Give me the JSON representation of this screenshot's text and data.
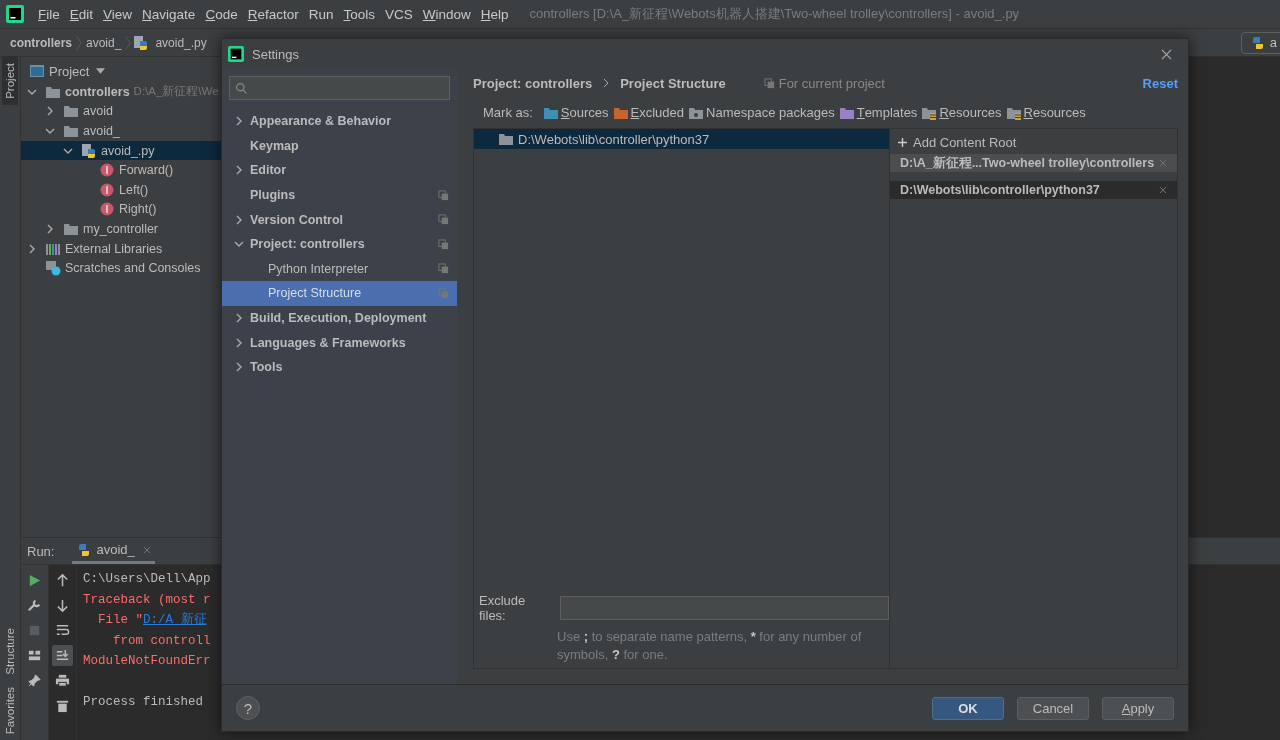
{
  "menu_bar": {
    "items": [
      {
        "label": "File",
        "mnemonic": true
      },
      {
        "label": "Edit",
        "mnemonic": true
      },
      {
        "label": "View",
        "mnemonic": true
      },
      {
        "label": "Navigate",
        "mnemonic": true
      },
      {
        "label": "Code",
        "mnemonic": true
      },
      {
        "label": "Refactor",
        "mnemonic": true
      },
      {
        "label": "Run",
        "mnemonic": false
      },
      {
        "label": "Tools",
        "mnemonic": true
      },
      {
        "label": "VCS",
        "mnemonic": false
      },
      {
        "label": "Window",
        "mnemonic": true
      },
      {
        "label": "Help",
        "mnemonic": true
      }
    ],
    "title": "controllers [D:\\A_新征程\\Webots机器人搭建\\Two-wheel trolley\\controllers] - avoid_.py"
  },
  "breadcrumb": [
    {
      "label": "controllers",
      "kind": "project"
    },
    {
      "label": "avoid_",
      "kind": "folder"
    },
    {
      "label": "avoid_.py",
      "kind": "python"
    }
  ],
  "editor_tab": {
    "label": "a"
  },
  "tool_stripe": {
    "top": [
      {
        "label": "Project",
        "selected": true
      }
    ],
    "bottom": [
      {
        "label": "Structure",
        "selected": false
      },
      {
        "label": "Favorites",
        "selected": false
      }
    ]
  },
  "project_panel": {
    "title": "Project",
    "tree": [
      {
        "label": "controllers",
        "hint": "D:\\A_新征程\\We",
        "kind": "folder",
        "bold": true,
        "expanded": true,
        "selected": false,
        "children": [
          {
            "label": "avoid",
            "kind": "folder",
            "expanded": false,
            "selected": false
          },
          {
            "label": "avoid_",
            "kind": "folder",
            "expanded": true,
            "selected": false,
            "children": [
              {
                "label": "avoid_.py",
                "kind": "python",
                "expanded": true,
                "selected": true,
                "children": [
                  {
                    "label": "Forward()",
                    "kind": "function",
                    "selected": false
                  },
                  {
                    "label": "Left()",
                    "kind": "function",
                    "selected": false
                  },
                  {
                    "label": "Right()",
                    "kind": "function",
                    "selected": false
                  }
                ]
              }
            ]
          },
          {
            "label": "my_controller",
            "kind": "folder",
            "expanded": false,
            "selected": false
          }
        ]
      },
      {
        "label": "External Libraries",
        "kind": "library",
        "expanded": false,
        "selected": false
      },
      {
        "label": "Scratches and Consoles",
        "kind": "scratches",
        "selected": false
      }
    ]
  },
  "run_panel": {
    "label": "Run:",
    "tab": {
      "label": "avoid_"
    },
    "lines": [
      {
        "kind": "output",
        "text": "C:\\Users\\Dell\\App"
      },
      {
        "kind": "error",
        "text": "Traceback (most r"
      },
      {
        "kind": "error",
        "text": "  File \"",
        "link": "D:/A_新征"
      },
      {
        "kind": "error",
        "text": "    from controll"
      },
      {
        "kind": "error",
        "text": "ModuleNotFoundErr"
      },
      {
        "kind": "status",
        "text": "Process finished"
      }
    ]
  },
  "settings": {
    "title": "Settings",
    "nav": [
      {
        "label": "Appearance & Behavior",
        "expanded": false,
        "shared": false,
        "selected": false
      },
      {
        "label": "Keymap",
        "shared": false,
        "selected": false
      },
      {
        "label": "Editor",
        "expanded": false,
        "shared": false,
        "selected": false
      },
      {
        "label": "Plugins",
        "shared": true,
        "selected": false
      },
      {
        "label": "Version Control",
        "expanded": false,
        "shared": true,
        "selected": false
      },
      {
        "label": "Project: controllers",
        "expanded": true,
        "shared": true,
        "selected": false,
        "children": [
          {
            "label": "Python Interpreter",
            "shared": true,
            "selected": false
          },
          {
            "label": "Project Structure",
            "shared": true,
            "selected": true
          }
        ]
      },
      {
        "label": "Build, Execution, Deployment",
        "expanded": false,
        "shared": false,
        "selected": false
      },
      {
        "label": "Languages & Frameworks",
        "expanded": false,
        "shared": false,
        "selected": false
      },
      {
        "label": "Tools",
        "expanded": false,
        "shared": false,
        "selected": false
      }
    ],
    "path": [
      "Project: controllers",
      "Project Structure"
    ],
    "scope": "For current project",
    "reset": "Reset",
    "mark_as": {
      "label": "Mark as:",
      "options": [
        {
          "label": "Sources",
          "kind": "folder",
          "color": "#3d8fb5",
          "mnemonic": true
        },
        {
          "label": "Excluded",
          "kind": "folder",
          "color": "#c3652f",
          "mnemonic": true
        },
        {
          "label": "Namespace packages",
          "kind": "namespace",
          "color": "#8c9399",
          "mnemonic": false
        },
        {
          "label": "Templates",
          "kind": "folder",
          "color": "#9a80c6",
          "mnemonic": true
        },
        {
          "label": "Resources",
          "kind": "resources",
          "color": "#8c9399",
          "mnemonic": true
        },
        {
          "label": "Resources",
          "kind": "resources",
          "color": "#8c9399",
          "mnemonic": true
        }
      ]
    },
    "folders": [
      {
        "label": "D:\\Webots\\lib\\controller\\python37",
        "selected": true
      }
    ],
    "add_root": "Add Content Root",
    "roots": [
      {
        "path": "D:\\A_新征程...Two-wheel trolley\\controllers",
        "selected": false
      },
      {
        "path": "D:\\Webots\\lib\\controller\\python37",
        "selected": true
      }
    ],
    "exclude": {
      "label": "Exclude files:",
      "hint": [
        {
          "text": "Use ",
          "bold": false
        },
        {
          "text": ";",
          "bold": true
        },
        {
          "text": " to separate name patterns, ",
          "bold": false
        },
        {
          "text": "*",
          "bold": true
        },
        {
          "text": " for any number of symbols, ",
          "bold": false
        },
        {
          "text": "?",
          "bold": true
        },
        {
          "text": " for one.",
          "bold": false
        }
      ]
    },
    "help": "?",
    "buttons": [
      {
        "label": "OK",
        "kind": "primary",
        "mnemonic": false
      },
      {
        "label": "Cancel",
        "kind": "normal",
        "mnemonic": false
      },
      {
        "label": "Apply",
        "kind": "normal",
        "mnemonic": true
      }
    ]
  }
}
